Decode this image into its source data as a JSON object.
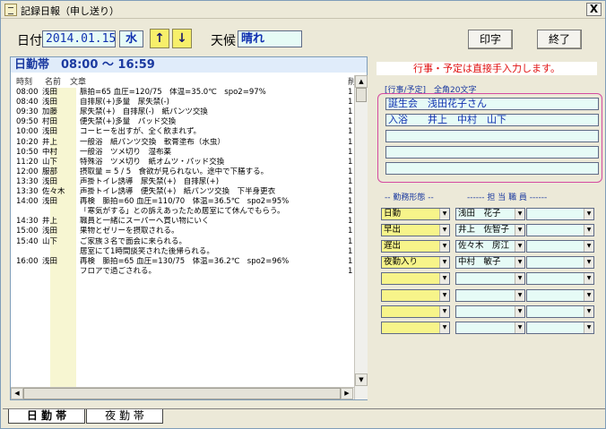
{
  "window": {
    "title": "記録日報（申し送り）",
    "close_label": "X"
  },
  "header": {
    "date_label": "日付",
    "date_value": "2014.01.15",
    "weekday": "水",
    "up_arrow": "↑",
    "down_arrow": "↓",
    "weather_label": "天候",
    "weather_value": "晴れ",
    "print_label": "印字",
    "exit_label": "終了"
  },
  "log_panel": {
    "title": "日勤帯　08:00 ～ 16:59",
    "col_time": "時刻",
    "col_name": "名前",
    "col_text": "文章",
    "col_n": "削",
    "rows": [
      {
        "time": "08:00",
        "name": "浅田",
        "text": "脈拍=65 血圧=120/75　体温=35.0℃　spo2=97%",
        "n": "1"
      },
      {
        "time": "08:40",
        "name": "浅田",
        "text": "自排尿(+)多量　尿失禁(-)",
        "n": "1"
      },
      {
        "time": "09:30",
        "name": "加藤",
        "text": "尿失禁(+)　自排尿(-)　紙パンツ交換",
        "n": "1"
      },
      {
        "time": "09:50",
        "name": "村田",
        "text": "便失禁(+)多量　パッド交換",
        "n": "1"
      },
      {
        "time": "10:00",
        "name": "浅田",
        "text": "コーヒーを出すが、全く飲まれず。",
        "n": "1"
      },
      {
        "time": "10:20",
        "name": "井上",
        "text": "一般浴　紙パンツ交換　軟膏塗布（水虫）",
        "n": "1"
      },
      {
        "time": "10:50",
        "name": "中村",
        "text": "一般浴　ツメ切り　湿布薬",
        "n": "1"
      },
      {
        "time": "11:20",
        "name": "山下",
        "text": "特殊浴　ツメ切り　紙オムツ・パッド交換",
        "n": "1"
      },
      {
        "time": "12:00",
        "name": "服部",
        "text": "摂取量 = 5 / 5　食欲が見られない。途中で下膳する。",
        "n": "1"
      },
      {
        "time": "13:30",
        "name": "浅田",
        "text": "声掛トイレ誘導　尿失禁(+)　自排尿(+)",
        "n": "1"
      },
      {
        "time": "13:30",
        "name": "佐々木",
        "text": "声掛トイレ誘導　便失禁(+)　紙パンツ交換　下半身更衣",
        "n": "1"
      },
      {
        "time": "14:00",
        "name": "浅田",
        "text": "再検　脈拍=60 血圧=110/70　体温=36.5℃　spo2=95%",
        "n": "1"
      },
      {
        "time": "",
        "name": "",
        "text": "「寒気がする」との訴えあったため居室にて休んでもらう。",
        "n": "1"
      },
      {
        "time": "14:30",
        "name": "井上",
        "text": "職員と一緒にスーパーへ買い物にいく",
        "n": "1"
      },
      {
        "time": "15:00",
        "name": "浅田",
        "text": "果物とゼリーを摂取される。",
        "n": "1"
      },
      {
        "time": "15:40",
        "name": "山下",
        "text": "ご家族３名で面会に来られる。",
        "n": "1"
      },
      {
        "time": "",
        "name": "",
        "text": "居室にて1時間談笑された後帰られる。",
        "n": "1"
      },
      {
        "time": "16:00",
        "name": "浅田",
        "text": "再検　脈拍=65 血圧=130/75　体温=36.2℃　spo2=96%",
        "n": "1"
      },
      {
        "time": "",
        "name": "",
        "text": "フロアで過ごされる。",
        "n": "1"
      }
    ]
  },
  "right_panel": {
    "notice": "行事・予定は直接手入力します。",
    "events_header": "[行事/予定]　全角20文字",
    "events": [
      "誕生会　浅田花子さん",
      "入浴　　井上　中村　山下",
      "",
      "",
      ""
    ],
    "shift_header": "-- 勤務形態 --",
    "staff_header": "------ 担 当 職 員 ------",
    "assignments": [
      {
        "shift": "日勤",
        "staff": "浅田　花子"
      },
      {
        "shift": "早出",
        "staff": "井上　佐智子"
      },
      {
        "shift": "遅出",
        "staff": "佐々木　房江"
      },
      {
        "shift": "夜勤入り",
        "staff": "中村　敏子"
      },
      {
        "shift": "",
        "staff": ""
      },
      {
        "shift": "",
        "staff": ""
      },
      {
        "shift": "",
        "staff": ""
      },
      {
        "shift": "",
        "staff": ""
      }
    ]
  },
  "tabs": [
    {
      "label": "日 勤 帯"
    },
    {
      "label": "夜 勤 帯"
    }
  ],
  "icons": {
    "dropdown": "▼",
    "scroll_up": "▲",
    "scroll_down": "▼",
    "scroll_left": "◀",
    "scroll_right": "▶"
  }
}
